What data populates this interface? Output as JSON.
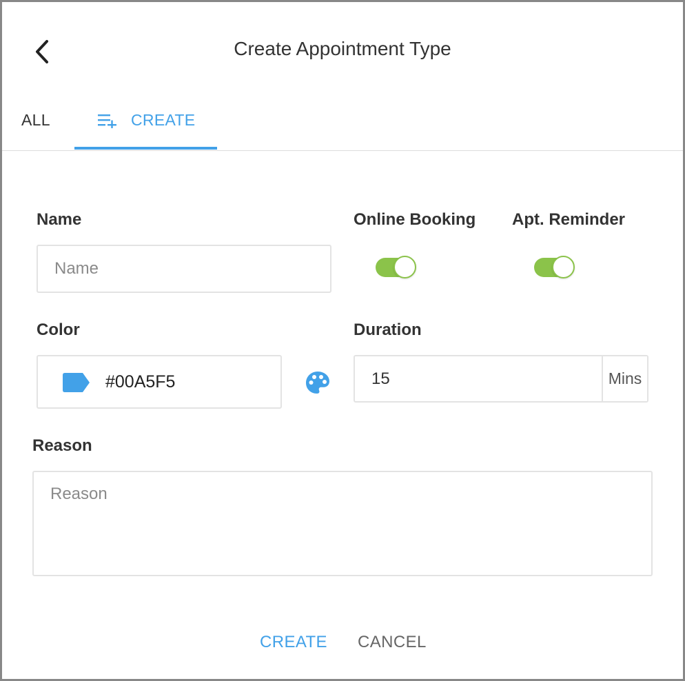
{
  "header": {
    "title": "Create Appointment Type",
    "back_icon": "chevron-left-icon"
  },
  "tabs": [
    {
      "label": "ALL",
      "active": false
    },
    {
      "label": "CREATE",
      "active": true,
      "icon": "playlist-add-icon"
    }
  ],
  "form": {
    "name": {
      "label": "Name",
      "placeholder": "Name",
      "value": ""
    },
    "online_booking": {
      "label": "Online Booking",
      "enabled": true
    },
    "apt_reminder": {
      "label": "Apt. Reminder",
      "enabled": true
    },
    "color": {
      "label": "Color",
      "value": "#00A5F5",
      "swatch_icon": "label-tag-icon",
      "picker_icon": "palette-icon"
    },
    "duration": {
      "label": "Duration",
      "value": "15",
      "unit": "Mins"
    },
    "reason": {
      "label": "Reason",
      "placeholder": "Reason",
      "value": ""
    }
  },
  "actions": {
    "create_label": "CREATE",
    "cancel_label": "CANCEL"
  },
  "colors": {
    "accent": "#42a1e8",
    "toggle_on": "#8bc34a",
    "text": "#333333",
    "border": "#e3e3e3"
  }
}
